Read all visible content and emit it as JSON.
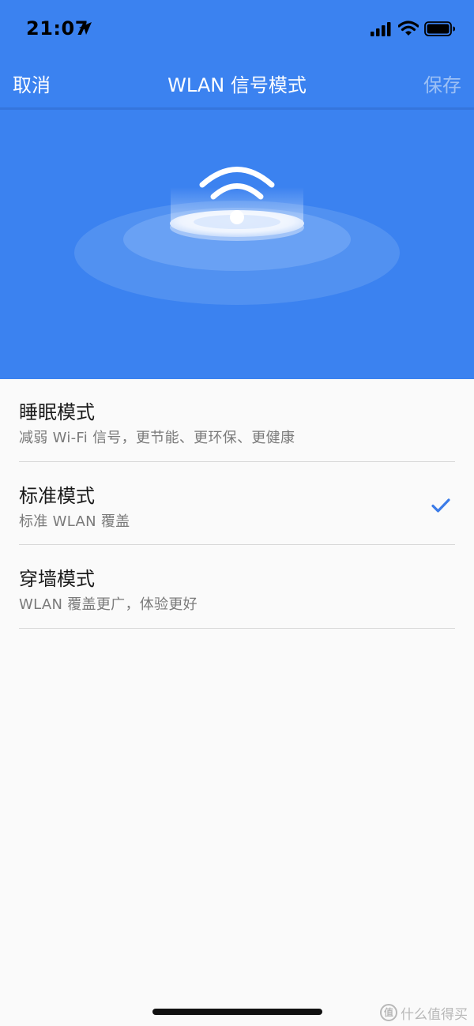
{
  "status_bar": {
    "time": "21:07",
    "icons": [
      "location-arrow-icon",
      "cellular-signal-icon",
      "wifi-icon",
      "battery-icon"
    ]
  },
  "nav": {
    "cancel_label": "取消",
    "title": "WLAN 信号模式",
    "save_label": "保存"
  },
  "hero": {
    "icon": "wifi-router-icon"
  },
  "modes": [
    {
      "title": "睡眠模式",
      "description": "减弱 Wi-Fi 信号，更节能、更环保、更健康",
      "selected": false
    },
    {
      "title": "标准模式",
      "description": "标准 WLAN 覆盖",
      "selected": true
    },
    {
      "title": "穿墙模式",
      "description": "WLAN 覆盖更广，体验更好",
      "selected": false
    }
  ],
  "watermark": {
    "logo_text": "值",
    "text": "什么值得买"
  },
  "colors": {
    "brand_blue": "#3b82f0",
    "save_disabled": "#9cc0f5",
    "check_blue": "#3b7be8",
    "text_primary": "#1a1a1a",
    "text_secondary": "#7a7a7a"
  }
}
